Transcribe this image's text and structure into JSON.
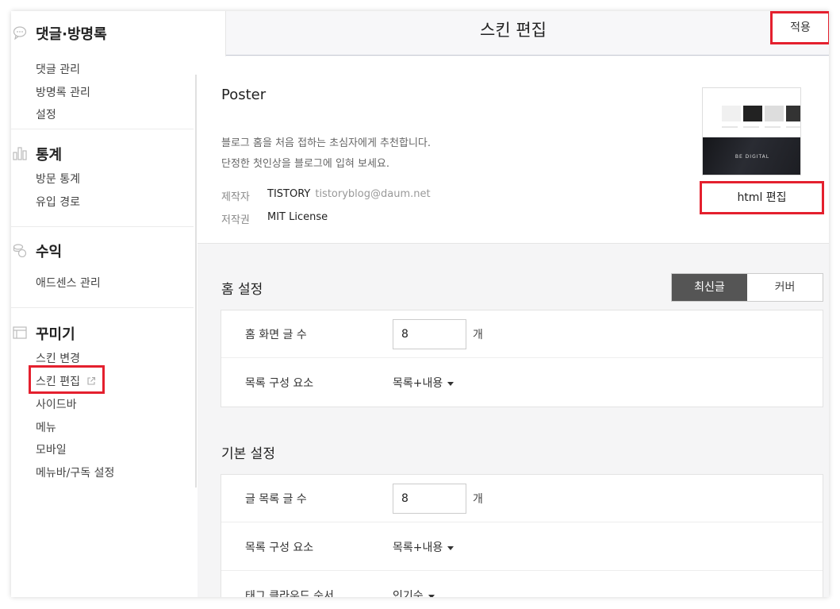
{
  "sidebar": {
    "sections": [
      {
        "title": "댓글·방명록",
        "icon": "speech-bubble-icon",
        "items": [
          "댓글 관리",
          "방명록 관리",
          "설정"
        ]
      },
      {
        "title": "통계",
        "icon": "bar-chart-icon",
        "items": [
          "방문 통계",
          "유입 경로"
        ]
      },
      {
        "title": "수익",
        "icon": "coins-icon",
        "items": [
          "애드센스 관리"
        ]
      },
      {
        "title": "꾸미기",
        "icon": "layout-icon",
        "items": [
          "스킨 변경",
          "스킨 편집",
          "사이드바",
          "메뉴",
          "모바일",
          "메뉴바/구독 설정"
        ]
      }
    ]
  },
  "header": {
    "title": "스킨 편집",
    "apply_label": "적용"
  },
  "skin": {
    "name": "Poster",
    "desc_line1": "블로그 홈을 처음 접하는 초심자에게 추천합니다.",
    "desc_line2": "단정한 첫인상을 블로그에 입혀 보세요.",
    "author_label": "제작자",
    "author": "TISTORY",
    "author_email": "tistoryblog@daum.net",
    "license_label": "저작권",
    "license": "MIT License",
    "thumbnail_caption": "BE DIGITAL",
    "html_edit_label": "html 편집"
  },
  "home_settings": {
    "title": "홈 설정",
    "toggle": [
      "최신글",
      "커버"
    ],
    "rows": [
      {
        "label": "홈 화면 글 수",
        "value": "8",
        "unit": "개"
      },
      {
        "label": "목록 구성 요소",
        "dropdown": "목록+내용"
      }
    ]
  },
  "basic_settings": {
    "title": "기본 설정",
    "rows": [
      {
        "label": "글 목록 글 수",
        "value": "8",
        "unit": "개"
      },
      {
        "label": "목록 구성 요소",
        "dropdown": "목록+내용"
      },
      {
        "label": "태그 클라우드 순서",
        "dropdown": "인기순"
      }
    ]
  },
  "colors": {
    "highlight": "#e4202e",
    "toggle_active": "#555555"
  }
}
